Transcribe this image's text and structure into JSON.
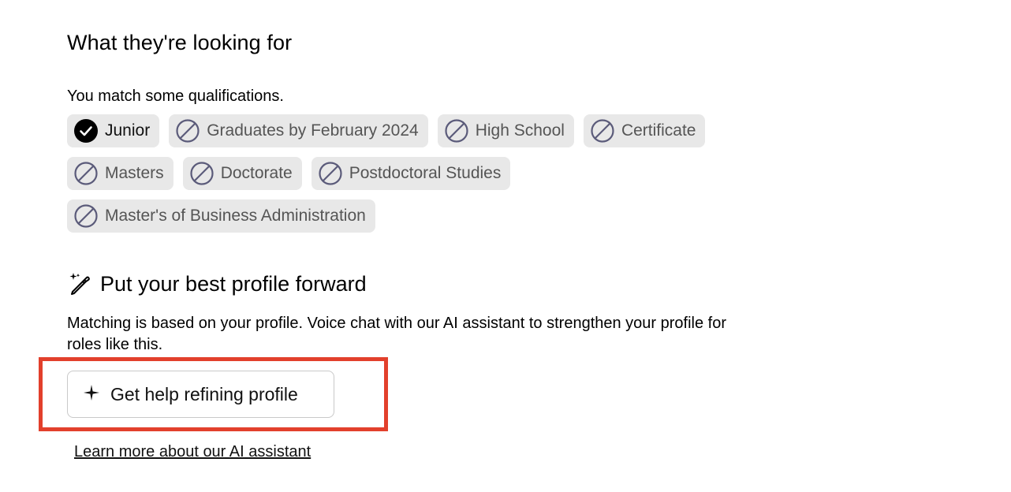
{
  "looking_for": {
    "heading": "What they're looking for",
    "match_text": "You match some qualifications.",
    "chips": [
      {
        "label": "Junior",
        "matched": true
      },
      {
        "label": "Graduates by February 2024",
        "matched": false
      },
      {
        "label": "High School",
        "matched": false
      },
      {
        "label": "Certificate",
        "matched": false
      },
      {
        "label": "Masters",
        "matched": false
      },
      {
        "label": "Doctorate",
        "matched": false
      },
      {
        "label": "Postdoctoral Studies",
        "matched": false
      },
      {
        "label": "Master's of Business Administration",
        "matched": false
      }
    ]
  },
  "profile": {
    "heading": "Put your best profile forward",
    "description": "Matching is based on your profile. Voice chat with our AI assistant to strengthen your profile for roles like this.",
    "button_label": "Get help refining profile",
    "link_label": "Learn more about our AI assistant"
  },
  "colors": {
    "highlight": "#e2402c",
    "chip_bg": "#e8e8e8",
    "not_matched_icon": "#5b5b7a"
  },
  "icons": {
    "matched": "check-circle-icon",
    "not_matched": "prohibited-icon",
    "heading": "magic-wand-icon",
    "button": "sparkle-icon"
  }
}
